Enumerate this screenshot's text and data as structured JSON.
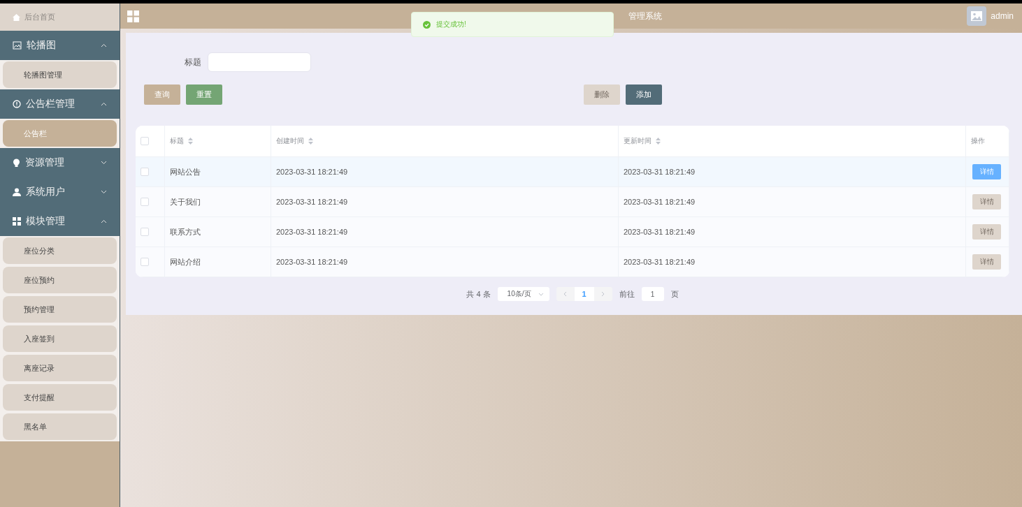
{
  "sidebar": {
    "home": {
      "label": "后台首页"
    },
    "groups": [
      {
        "kind": "image",
        "label": "轮播图",
        "expanded": true,
        "children": [
          {
            "label": "轮播图管理",
            "selected": false
          }
        ]
      },
      {
        "kind": "alert",
        "label": "公告栏管理",
        "expanded": true,
        "children": [
          {
            "label": "公告栏",
            "selected": true
          }
        ]
      },
      {
        "kind": "bulb",
        "label": "资源管理",
        "expanded": false
      },
      {
        "kind": "user",
        "label": "系统用户",
        "expanded": false
      },
      {
        "kind": "grid",
        "label": "模块管理",
        "expanded": true,
        "children": [
          {
            "label": "座位分类",
            "selected": false
          },
          {
            "label": "座位预约",
            "selected": false
          },
          {
            "label": "预约管理",
            "selected": false
          },
          {
            "label": "入座签到",
            "selected": false
          },
          {
            "label": "离座记录",
            "selected": false
          },
          {
            "label": "支付提醒",
            "selected": false
          },
          {
            "label": "黑名单",
            "selected": false
          }
        ]
      }
    ]
  },
  "header": {
    "title": "管理系统",
    "user": "admin"
  },
  "toast": {
    "message": "提交成功!"
  },
  "search": {
    "label": "标题",
    "buttons": [
      {
        "kind": "query",
        "label": "查询"
      },
      {
        "kind": "reset",
        "label": "重置"
      }
    ],
    "actions": [
      {
        "kind": "delete",
        "label": "删除",
        "disabled": true
      },
      {
        "kind": "add",
        "label": "添加",
        "disabled": false
      }
    ]
  },
  "table": {
    "select_all_checked": false,
    "columns": [
      "标题",
      "创建时间",
      "更新时间",
      "操作"
    ],
    "rows": [
      {
        "title": "网站公告",
        "created": "2023-03-31 18:21:49",
        "updated": "2023-03-31 18:21:49",
        "action": "详情",
        "checked": false,
        "hovered": true
      },
      {
        "title": "关于我们",
        "created": "2023-03-31 18:21:49",
        "updated": "2023-03-31 18:21:49",
        "action": "详情",
        "checked": false,
        "hovered": false
      },
      {
        "title": "联系方式",
        "created": "2023-03-31 18:21:49",
        "updated": "2023-03-31 18:21:49",
        "action": "详情",
        "checked": false,
        "hovered": false
      },
      {
        "title": "网站介绍",
        "created": "2023-03-31 18:21:49",
        "updated": "2023-03-31 18:21:49",
        "action": "详情",
        "checked": false,
        "hovered": false
      }
    ]
  },
  "pagination": {
    "total": "共 4 条",
    "page_size": "10条/页",
    "pages": [
      {
        "label": "1",
        "selected": true
      }
    ],
    "goto_label": "前往",
    "goto_value": "1",
    "page_suffix": "页"
  }
}
